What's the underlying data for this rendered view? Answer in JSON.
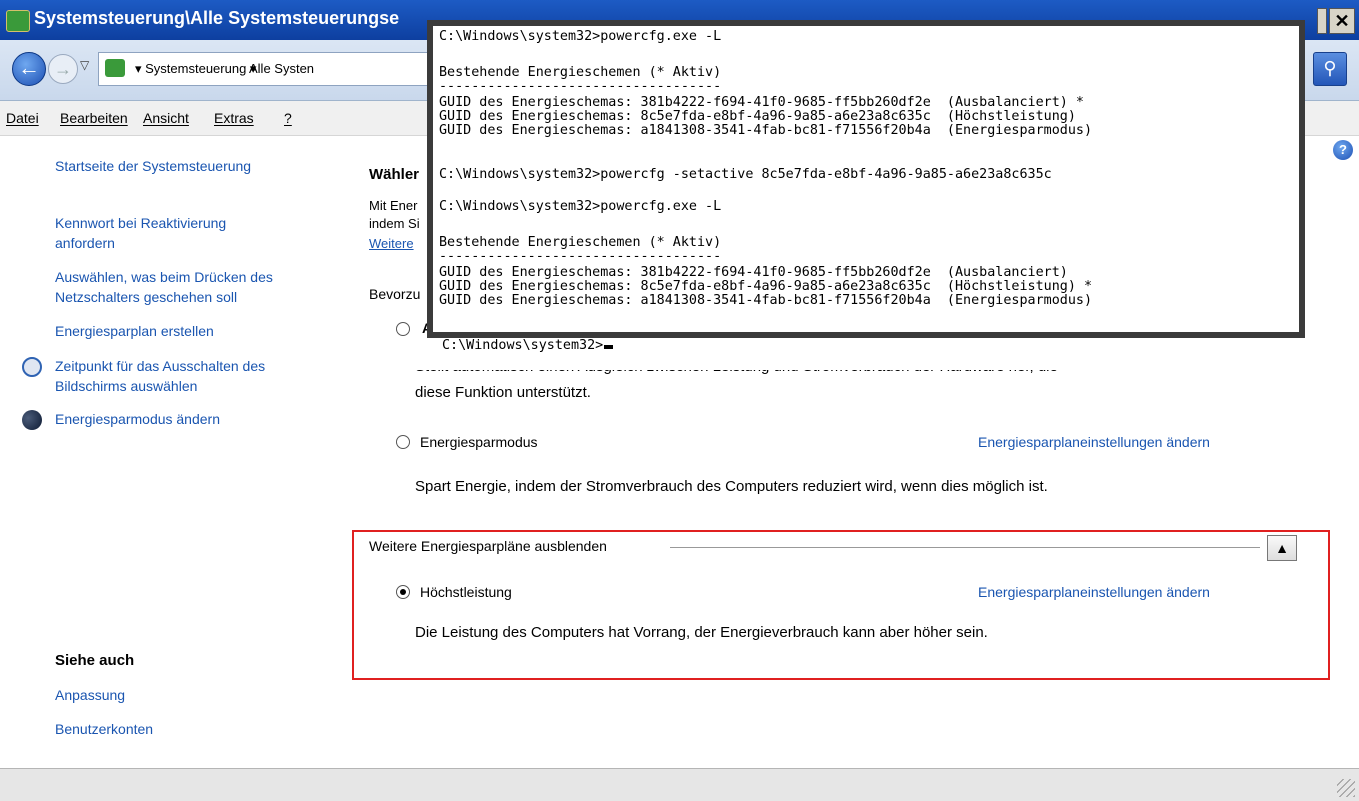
{
  "window": {
    "title": "Systemsteuerung\\Alle Systemsteuerungse"
  },
  "address": {
    "crumb1": "▾ Systemsteuerung ▾",
    "crumb2": "Alle Systen"
  },
  "menu": {
    "file": "Datei",
    "edit": "Bearbeiten",
    "view": "Ansicht",
    "extras": "Extras",
    "help": "?"
  },
  "left": {
    "home": "Startseite der Systemsteuerung",
    "password_1": "Kennwort bei Reaktivierung",
    "password_2": "anfordern",
    "power_btn_1": "Auswählen, was beim Drücken des",
    "power_btn_2": "Netzschalters geschehen soll",
    "create_plan": "Energiesparplan erstellen",
    "display_off_1": "Zeitpunkt für das Ausschalten des",
    "display_off_2": "Bildschirms auswählen",
    "sleep": "Energiesparmodus ändern",
    "see_also": "Siehe auch",
    "personalize": "Anpassung",
    "accounts": "Benutzerkonten"
  },
  "main": {
    "heading_fragment": "Wähler",
    "intro_line1": "Mit Ener",
    "intro_line2": "indem Si",
    "more_link": "Weitere",
    "preferred": "Bevorzu",
    "balanced_partial": "A",
    "balanced_desc_line1": "Stellt automatisch einen Ausgleich zwischen Leistung und Stromverbrauch der Hardware her, die",
    "balanced_desc_line2": "diese Funktion unterstützt.",
    "plan_saver_label": "Energiesparmodus",
    "plan_saver_settings": "Energiesparplaneinstellungen ändern",
    "plan_saver_desc": "Spart Energie, indem der Stromverbrauch des Computers reduziert wird, wenn dies möglich ist.",
    "expander_label": "Weitere Energiesparpläne ausblenden",
    "expander_arrow": "▲",
    "plan_high_label": "Höchstleistung",
    "plan_high_settings": "Energiesparplaneinstellungen ändern",
    "plan_high_desc": "Die Leistung des Computers hat Vorrang, der Energieverbrauch kann aber höher sein."
  },
  "terminal": {
    "lines": [
      "C:\\Windows\\system32>powercfg.exe -L",
      "",
      "Bestehende Energieschemen (* Aktiv)",
      "-----------------------------------",
      "GUID des Energieschemas: 381b4222-f694-41f0-9685-ff5bb260df2e  (Ausbalanciert) *",
      "GUID des Energieschemas: 8c5e7fda-e8bf-4a96-9a85-a6e23a8c635c  (Höchstleistung)",
      "GUID des Energieschemas: a1841308-3541-4fab-bc81-f71556f20b4a  (Energiesparmodus)",
      "",
      "C:\\Windows\\system32>powercfg -setactive 8c5e7fda-e8bf-4a96-9a85-a6e23a8c635c",
      "",
      "C:\\Windows\\system32>powercfg.exe -L",
      "",
      "Bestehende Energieschemen (* Aktiv)",
      "-----------------------------------",
      "GUID des Energieschemas: 381b4222-f694-41f0-9685-ff5bb260df2e  (Ausbalanciert)",
      "GUID des Energieschemas: 8c5e7fda-e8bf-4a96-9a85-a6e23a8c635c  (Höchstleistung) *",
      "GUID des Energieschemas: a1841308-3541-4fab-bc81-f71556f20b4a  (Energiesparmodus)"
    ],
    "prompt": "C:\\Windows\\system32>"
  },
  "colors": {
    "link": "#1a55b0",
    "highlight_border": "#e02020",
    "title_bar": "#0d3fa0"
  }
}
